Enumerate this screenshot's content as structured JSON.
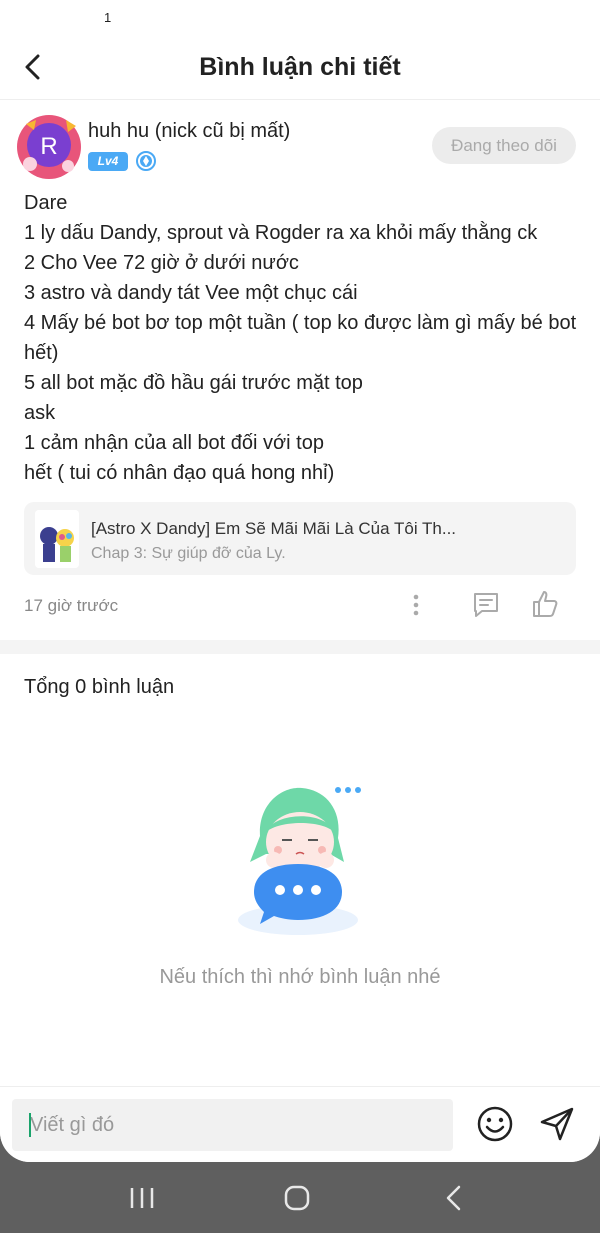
{
  "status_bar": {
    "notification_count": "1"
  },
  "header": {
    "title": "Bình luận chi tiết",
    "back_icon": "chevron-left-icon"
  },
  "comment": {
    "username": "huh hu (nick cũ bị mất)",
    "avatar_letter": "R",
    "level_badge": "Lv4",
    "follow_label": "Đang theo dõi",
    "lines": [
      "Dare",
      "1 ly dấu Dandy, sprout và Rogder ra xa khỏi mấy thằng ck",
      "2 Cho Vee 72 giờ ở dưới nước",
      "3 astro và dandy tát Vee một chục cái",
      "4 Mấy bé bot bơ top một tuần ( top ko được làm gì mấy bé bot hết)",
      "5 all bot mặc đồ hầu gái trước mặt top",
      "ask",
      "1 cảm nhận của all bot đối với top",
      "hết ( tui có nhân đạo quá hong nhỉ)"
    ],
    "story": {
      "title": "[Astro X Dandy] Em Sẽ Mãi Mãi Là Của Tôi Th...",
      "chapter": "Chap 3: Sự giúp đỡ của Ly."
    },
    "time": "17 giờ trước"
  },
  "replies": {
    "total_label": "Tổng 0 bình luận",
    "empty_text": "Nếu thích thì nhớ bình luận nhé"
  },
  "input": {
    "placeholder": "Viết gì đó"
  },
  "colors": {
    "accent_blue": "#4aa9f5",
    "illustration_green": "#6ed8a8",
    "bubble_blue": "#3e8ef0"
  }
}
